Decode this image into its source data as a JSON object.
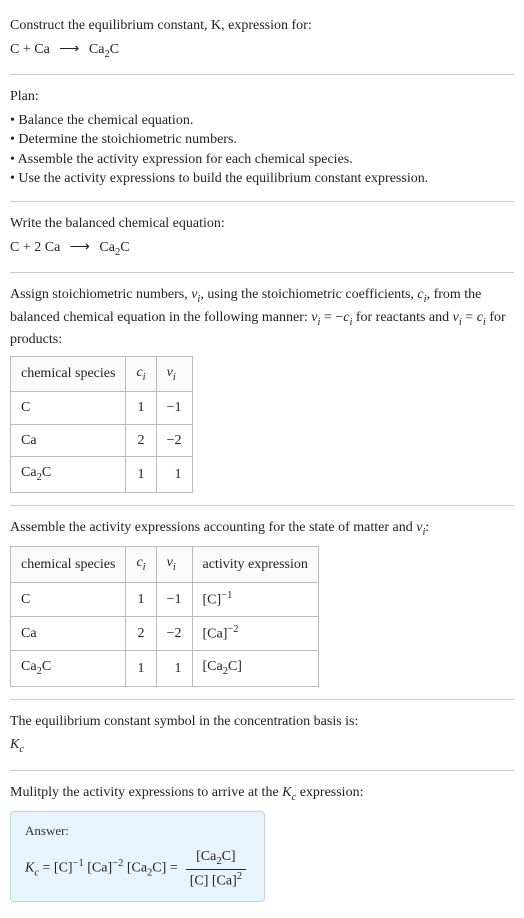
{
  "header": {
    "title": "Construct the equilibrium constant, K, expression for:",
    "equation_left": "C + Ca",
    "arrow": "⟶",
    "equation_right": "Ca",
    "equation_right_sub": "2",
    "equation_right_end": "C"
  },
  "plan": {
    "title": "Plan:",
    "items": [
      "• Balance the chemical equation.",
      "• Determine the stoichiometric numbers.",
      "• Assemble the activity expression for each chemical species.",
      "• Use the activity expressions to build the equilibrium constant expression."
    ]
  },
  "balanced": {
    "title": "Write the balanced chemical equation:",
    "left": "C + 2 Ca",
    "arrow": "⟶",
    "right_a": "Ca",
    "right_sub": "2",
    "right_b": "C"
  },
  "stoich": {
    "desc_a": "Assign stoichiometric numbers, ",
    "nu": "ν",
    "nu_sub": "i",
    "desc_b": ", using the stoichiometric coefficients, ",
    "c": "c",
    "c_sub": "i",
    "desc_c": ", from the balanced chemical equation in the following manner: ",
    "rel1_a": "ν",
    "rel1_b": " = −",
    "rel1_c": "c",
    "desc_d": " for reactants and ",
    "rel2_a": "ν",
    "rel2_b": " = ",
    "rel2_c": "c",
    "desc_e": " for products:",
    "table": {
      "headers": {
        "species": "chemical species",
        "ci": "c",
        "ci_sub": "i",
        "nui": "ν",
        "nui_sub": "i"
      },
      "rows": [
        {
          "species": "C",
          "ci": "1",
          "nui": "−1"
        },
        {
          "species": "Ca",
          "ci": "2",
          "nui": "−2"
        },
        {
          "species_a": "Ca",
          "species_sub": "2",
          "species_b": "C",
          "ci": "1",
          "nui": "1"
        }
      ]
    }
  },
  "activity": {
    "desc_a": "Assemble the activity expressions accounting for the state of matter and ",
    "nu": "ν",
    "nu_sub": "i",
    "desc_b": ":",
    "table": {
      "headers": {
        "species": "chemical species",
        "ci": "c",
        "ci_sub": "i",
        "nui": "ν",
        "nui_sub": "i",
        "act": "activity expression"
      },
      "rows": [
        {
          "species": "C",
          "ci": "1",
          "nui": "−1",
          "act_base": "[C]",
          "act_exp": "−1"
        },
        {
          "species": "Ca",
          "ci": "2",
          "nui": "−2",
          "act_base": "[Ca]",
          "act_exp": "−2"
        },
        {
          "species_a": "Ca",
          "species_sub": "2",
          "species_b": "C",
          "ci": "1",
          "nui": "1",
          "act_a": "[Ca",
          "act_sub": "2",
          "act_b": "C]"
        }
      ]
    }
  },
  "symbol": {
    "desc": "The equilibrium constant symbol in the concentration basis is:",
    "kc_a": "K",
    "kc_sub": "c"
  },
  "multiply": {
    "desc_a": "Mulitply the activity expressions to arrive at the ",
    "kc_a": "K",
    "kc_sub": "c",
    "desc_b": " expression:"
  },
  "answer": {
    "label": "Answer:",
    "kc_a": "K",
    "kc_sub": "c",
    "eq": " = ",
    "term1_base": "[C]",
    "term1_exp": "−1",
    "term2_base": " [Ca]",
    "term2_exp": "−2",
    "term3_a": " [Ca",
    "term3_sub": "2",
    "term3_b": "C] = ",
    "frac_num_a": "[Ca",
    "frac_num_sub": "2",
    "frac_num_b": "C]",
    "frac_den_a": "[C] [Ca]",
    "frac_den_exp": "2"
  }
}
